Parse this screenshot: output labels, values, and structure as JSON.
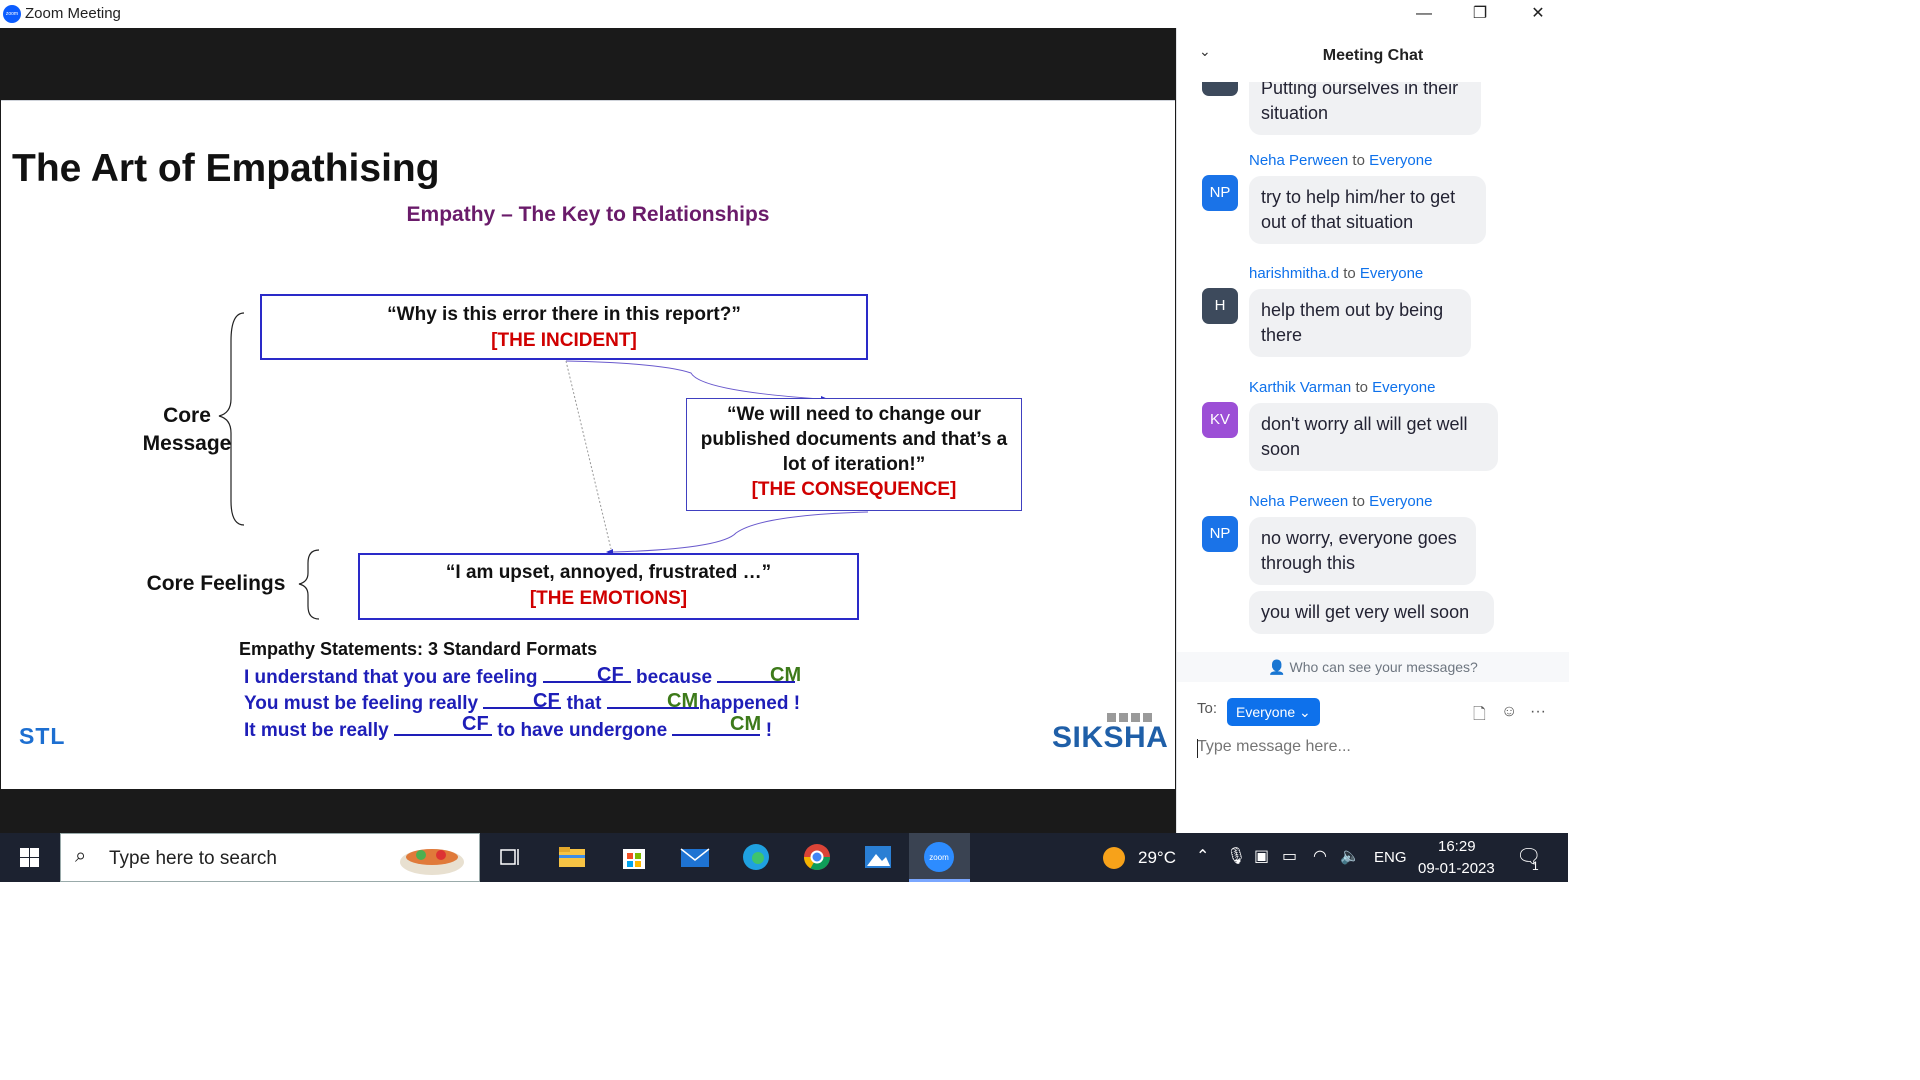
{
  "window": {
    "title": "Zoom Meeting",
    "minimize": "—",
    "restore": "❐",
    "close": "✕"
  },
  "slide": {
    "title": "The Art of Empathising",
    "subtitle": "Empathy – The Key to Relationships",
    "incident": {
      "quote": "“Why is this error there in this report?”",
      "tag": "[THE INCIDENT]"
    },
    "consequence": {
      "line1": "“We will need to change our",
      "line2": "published documents and that’s a",
      "line3": "lot of iteration!”",
      "tag": "[THE CONSEQUENCE]"
    },
    "emotions": {
      "quote": "“I am upset, annoyed, frustrated …”",
      "tag": "[THE EMOTIONS]"
    },
    "core_message_line1": "Core",
    "core_message_line2": "Message",
    "core_feelings": "Core Feelings",
    "statements_heading": "Empathy Statements: 3 Standard Formats",
    "statement1": {
      "a": "I understand that you are feeling ",
      "b": " because "
    },
    "statement2": {
      "a": "You must be feeling really ",
      "b": " that ",
      "c": "happened !"
    },
    "statement3": {
      "a": "It must be really ",
      "b": " to have undergone ",
      "c": " !"
    },
    "cf": "CF",
    "cm": "CM",
    "logo_left": "STL",
    "logo_right": "SIKSHA"
  },
  "chat": {
    "title": "Meeting Chat",
    "messages": [
      {
        "sender": "",
        "to": "",
        "avatar_initials": "",
        "avatar_color": "#3d4a5c",
        "text_line1": "Putting ourselves in their",
        "text_line2": "situation"
      },
      {
        "sender": "Neha Perween",
        "to": "Everyone",
        "avatar_initials": "NP",
        "avatar_color": "#1a73e8",
        "text_line1": "try to help him/her to get",
        "text_line2": "out of that situation"
      },
      {
        "sender": "harishmitha.d",
        "to": "Everyone",
        "avatar_initials": "H",
        "avatar_color": "#3d4a5c",
        "text_line1": "help them out by being",
        "text_line2": "there"
      },
      {
        "sender": "Karthik Varman",
        "to": "Everyone",
        "avatar_initials": "KV",
        "avatar_color": "#9c4fd6",
        "text_line1": "don't worry all will get well",
        "text_line2": "soon"
      },
      {
        "sender": "Neha Perween",
        "to": "Everyone",
        "avatar_initials": "NP",
        "avatar_color": "#1a73e8",
        "text_line1": "no worry, everyone goes",
        "text_line2": "through this"
      },
      {
        "sender": "",
        "to": "",
        "avatar_initials": "",
        "avatar_color": "",
        "text_line1": "you will get very well soon",
        "text_line2": ""
      }
    ],
    "to_word": "to",
    "who_can_see": "Who can see your messages?",
    "to_label": "To:",
    "recipient": "Everyone",
    "input_placeholder": "Type message here..."
  },
  "taskbar": {
    "search_placeholder": "Type here to search",
    "temperature": "29°C",
    "language": "ENG",
    "time": "16:29",
    "date": "09-01-2023",
    "notification_count": "1"
  }
}
